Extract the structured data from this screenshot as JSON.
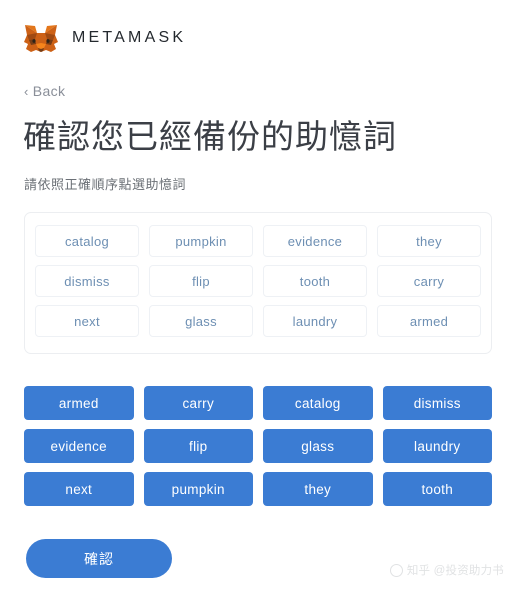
{
  "brand": {
    "name": "METAMASK",
    "logo_icon": "metamask-fox-icon",
    "logo_colors": {
      "light": "#e2761b",
      "mid": "#cd6116",
      "dark": "#a04a12",
      "shadow": "#763d16",
      "cream": "#f6851b"
    }
  },
  "nav": {
    "back_label": "Back",
    "back_chevron": "‹"
  },
  "page": {
    "title": "確認您已經備份的助憶詞",
    "subtitle": "請依照正確順序點選助憶詞"
  },
  "selected_words": [
    "catalog",
    "pumpkin",
    "evidence",
    "they",
    "dismiss",
    "flip",
    "tooth",
    "carry",
    "next",
    "glass",
    "laundry",
    "armed"
  ],
  "word_bank": [
    "armed",
    "carry",
    "catalog",
    "dismiss",
    "evidence",
    "flip",
    "glass",
    "laundry",
    "next",
    "pumpkin",
    "they",
    "tooth"
  ],
  "confirm": {
    "label": "確認"
  },
  "watermark": {
    "text": "知乎 @投资助力书",
    "icon": "watermark-circle-icon"
  },
  "colors": {
    "accent_blue": "#3b7cd3",
    "chip_text": "#6d8fb3",
    "title_gray": "#3b3f46",
    "subtitle_gray": "#6b7076",
    "border_light": "#eceef1",
    "background": "#ffffff"
  }
}
